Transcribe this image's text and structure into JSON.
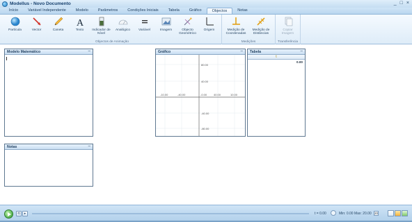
{
  "window": {
    "title": "Modellus - Novo Documento",
    "controls": [
      "_",
      "□",
      "×"
    ]
  },
  "menu": {
    "tabs": [
      {
        "label": "Início",
        "active": false
      },
      {
        "label": "Variável Independente",
        "active": false
      },
      {
        "label": "Modelo",
        "active": false
      },
      {
        "label": "Parâmetros",
        "active": false
      },
      {
        "label": "Condições Iniciais",
        "active": false
      },
      {
        "label": "Tabela",
        "active": false
      },
      {
        "label": "Gráfico",
        "active": false
      },
      {
        "label": "Objectos",
        "active": true
      },
      {
        "label": "Notas",
        "active": false
      }
    ]
  },
  "ribbon": {
    "groups": [
      {
        "label": "Objectos de Animação",
        "tools": [
          {
            "label": "Partícula",
            "icon": "particle-icon"
          },
          {
            "label": "Vector",
            "icon": "vector-icon"
          },
          {
            "label": "Caneta",
            "icon": "pen-icon"
          },
          {
            "label": "Texto",
            "icon": "text-icon"
          },
          {
            "label": "Indicador de Nível",
            "icon": "level-indicator-icon"
          },
          {
            "label": "Analógico",
            "icon": "analog-gauge-icon"
          },
          {
            "label": "Variável",
            "icon": "variable-icon"
          },
          {
            "label": "Imagem",
            "icon": "image-icon"
          },
          {
            "label": "Objecto Geométrico",
            "icon": "geometric-object-icon"
          },
          {
            "label": "Origem",
            "icon": "origin-icon"
          }
        ]
      },
      {
        "label": "Medições",
        "tools": [
          {
            "label": "Medição de Coordenadas",
            "icon": "coordinate-measure-icon"
          },
          {
            "label": "Medição de Distâncias",
            "icon": "distance-measure-icon"
          }
        ]
      },
      {
        "label": "Transferência",
        "tools": [
          {
            "label": "Copiar Imagem",
            "icon": "copy-image-icon"
          }
        ]
      }
    ]
  },
  "panels": {
    "model": {
      "title": "Modelo Matemático"
    },
    "notes": {
      "title": "Notas"
    },
    "graph": {
      "title": "Gráfico",
      "x_ticks": [
        "-10.00",
        "-40.00",
        "-0.00",
        "40.00",
        "10.00"
      ],
      "y_ticks": [
        "80.00",
        "40.00",
        "-40.00",
        "-80.00"
      ]
    },
    "table": {
      "title": "Tabela",
      "column_header": "t",
      "first_value": "0.00"
    }
  },
  "status": {
    "t_readout": "t = 0.00",
    "min_max": "Min: 0.00  Max: 20.00",
    "step": "20"
  },
  "colors": {
    "accent": "#2b7bc0",
    "play": "#2d9a2d"
  }
}
